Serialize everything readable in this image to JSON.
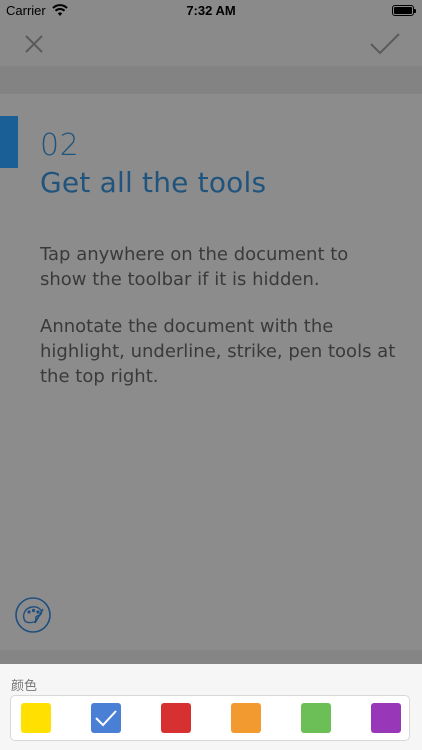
{
  "status_bar": {
    "carrier": "Carrier",
    "time": "7:32 AM"
  },
  "nav": {
    "close_icon": "close-icon",
    "done_icon": "checkmark-icon"
  },
  "step": {
    "number": "02",
    "title": "Get all the tools",
    "paragraphs": [
      "Tap anywhere on the document to show the toolbar if it is hidden.",
      "Annotate the document with the highlight, underline, strike, pen tools at the top right."
    ]
  },
  "palette_icon": "palette-icon",
  "color_sheet": {
    "label": "颜色",
    "selected_index": 1,
    "colors": [
      "#FFE000",
      "#4A7FD6",
      "#D63030",
      "#F29A30",
      "#6CBF56",
      "#9838B8"
    ]
  }
}
